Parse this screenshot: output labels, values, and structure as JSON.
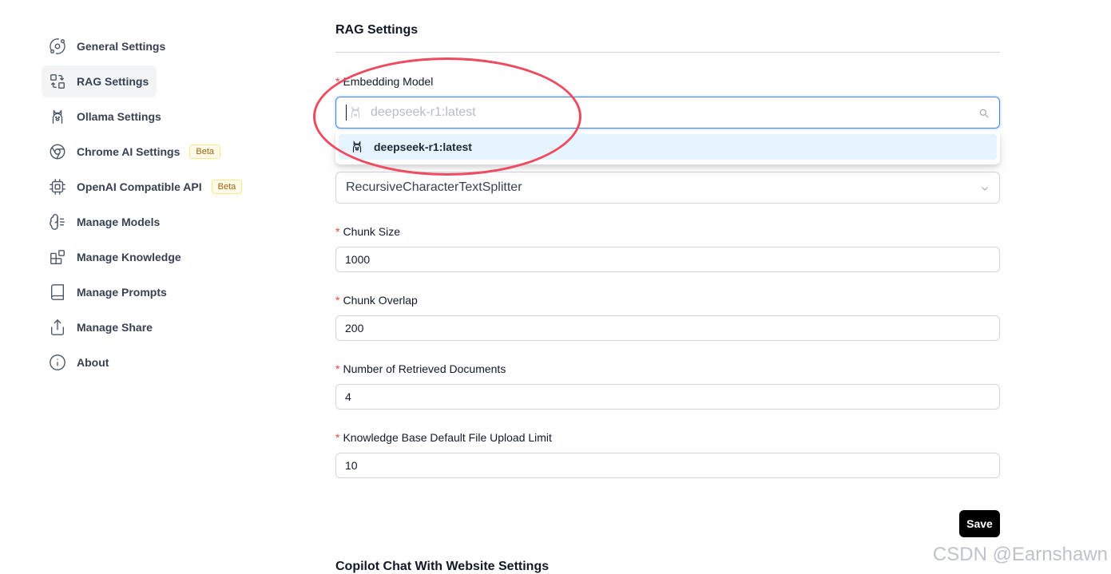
{
  "sidebar": {
    "items": [
      {
        "label": "General Settings",
        "icon": "orbit-icon"
      },
      {
        "label": "RAG Settings",
        "icon": "combine-icon",
        "active": true
      },
      {
        "label": "Ollama Settings",
        "icon": "ollama-icon"
      },
      {
        "label": "Chrome AI Settings",
        "icon": "chrome-icon",
        "badge": "Beta"
      },
      {
        "label": "OpenAI Compatible API",
        "icon": "cpu-icon",
        "badge": "Beta"
      },
      {
        "label": "Manage Models",
        "icon": "brain-icon"
      },
      {
        "label": "Manage Knowledge",
        "icon": "blocks-icon"
      },
      {
        "label": "Manage Prompts",
        "icon": "book-icon"
      },
      {
        "label": "Manage Share",
        "icon": "share-icon"
      },
      {
        "label": "About",
        "icon": "info-icon"
      }
    ]
  },
  "main": {
    "title": "RAG Settings",
    "embedding_model": {
      "label": "Embedding Model",
      "placeholder": "deepseek-r1:latest",
      "options": [
        "deepseek-r1:latest"
      ]
    },
    "splitter": {
      "value": "RecursiveCharacterTextSplitter"
    },
    "chunk_size": {
      "label": "Chunk Size",
      "value": "1000"
    },
    "chunk_overlap": {
      "label": "Chunk Overlap",
      "value": "200"
    },
    "retrieved_docs": {
      "label": "Number of Retrieved Documents",
      "value": "4"
    },
    "upload_limit": {
      "label": "Knowledge Base Default File Upload Limit",
      "value": "10"
    },
    "save_label": "Save",
    "next_section_title": "Copilot Chat With Website Settings"
  },
  "colors": {
    "accent_focus": "#3b82f6",
    "required": "#ef4444",
    "option_highlight": "#e6f4ff",
    "annotation": "#ef4a5f"
  },
  "watermark": "CSDN @Earnshawn"
}
